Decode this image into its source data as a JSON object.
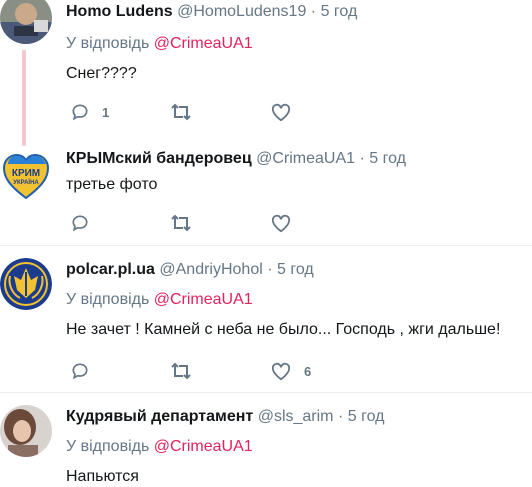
{
  "tweets": [
    {
      "name": "Homo Ludens",
      "handle": "@HomoLudens19",
      "separator": "·",
      "time": "5 год",
      "reply_prefix": "У відповідь",
      "reply_mention": "@CrimeaUA1",
      "text": "Снег????",
      "reply_count": "1",
      "retweet_count": "",
      "like_count": ""
    },
    {
      "name": "КРЫМский бандеровец",
      "handle": "@CrimeaUA1",
      "separator": "·",
      "time": "5 год",
      "text": "третье фото",
      "avatar_text_top": "КРИМ",
      "avatar_text_bottom": "УКРАЇНА",
      "reply_count": "",
      "retweet_count": "",
      "like_count": ""
    },
    {
      "name": "polcar.pl.ua",
      "handle": "@AndriyHohol",
      "separator": "·",
      "time": "5 год",
      "reply_prefix": "У відповідь",
      "reply_mention": "@CrimeaUA1",
      "text": "Не зачет ! Камней с неба не было... Господь , жги дальше!",
      "reply_count": "",
      "retweet_count": "",
      "like_count": "6"
    },
    {
      "name": "Кудрявый департамент",
      "handle": "@sls_arim",
      "separator": "·",
      "time": "5 год",
      "reply_prefix": "У відповідь",
      "reply_mention": "@CrimeaUA1",
      "text": "Напьются"
    }
  ],
  "colors": {
    "name": "#14171a",
    "secondary": "#657786",
    "mention": "#e0245e",
    "thread_line": "#f4c6d0",
    "divider": "#e6ecf0"
  }
}
